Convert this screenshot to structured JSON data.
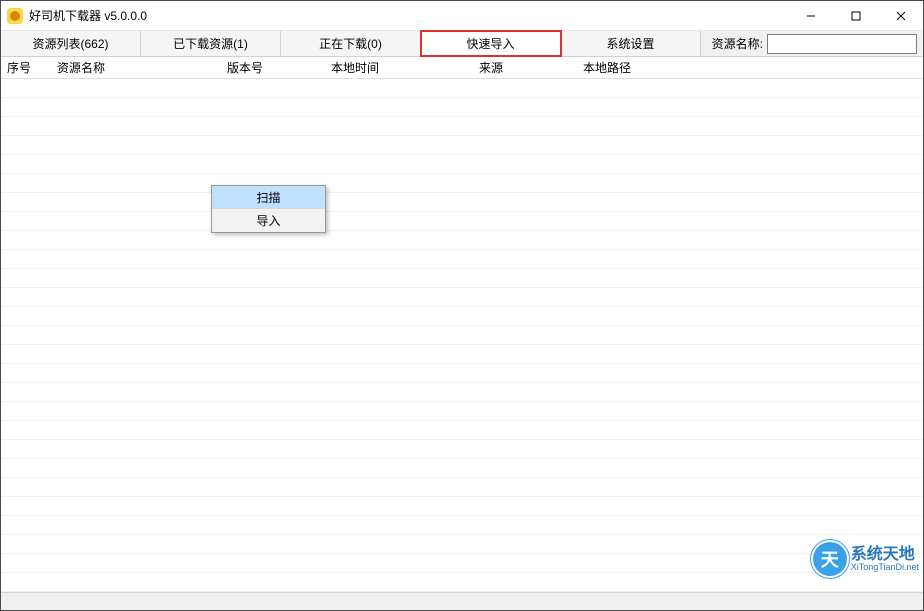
{
  "window": {
    "title": "好司机下载器 v5.0.0.0"
  },
  "tabs": [
    {
      "label": "资源列表(662)"
    },
    {
      "label": "已下载资源(1)"
    },
    {
      "label": "正在下载(0)"
    },
    {
      "label": "快速导入",
      "highlight": true
    },
    {
      "label": "系统设置"
    }
  ],
  "search": {
    "label": "资源名称:",
    "value": ""
  },
  "columns": [
    "序号",
    "资源名称",
    "版本号",
    "本地时间",
    "来源",
    "本地路径"
  ],
  "context_menu": [
    {
      "label": "扫描",
      "selected": true
    },
    {
      "label": "导入",
      "selected": false
    }
  ],
  "watermark": {
    "brand_cn": "系统天地",
    "brand_en": "XiTongTianDi.net"
  }
}
